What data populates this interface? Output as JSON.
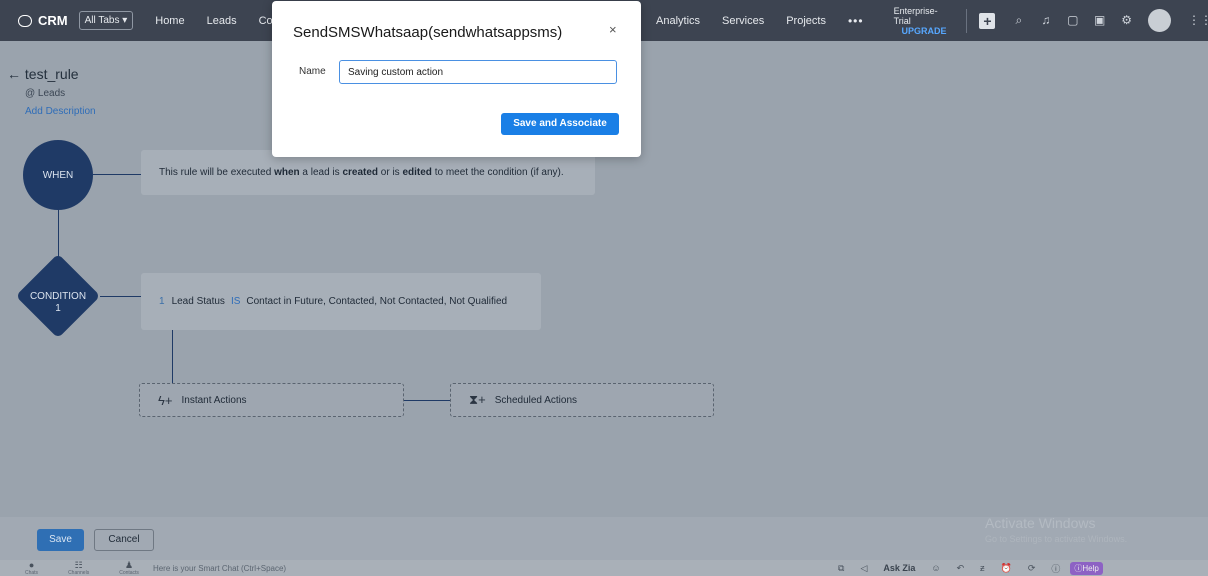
{
  "topbar": {
    "brand": "CRM",
    "all_tabs": "All Tabs ▾",
    "nav_left": [
      "Home",
      "Leads",
      "Co"
    ],
    "nav_right": [
      "Analytics",
      "Services",
      "Projects"
    ],
    "more": "•••",
    "trial_label": "Enterprise-Trial",
    "upgrade_label": "UPGRADE"
  },
  "rule": {
    "name": "test_rule",
    "module": "@ Leads",
    "add_description": "Add Description"
  },
  "flow": {
    "when_label": "WHEN",
    "when_text_parts": [
      "This rule will be executed ",
      "when",
      " a lead is ",
      "created",
      " or is ",
      "edited",
      " to meet the condition (if any)."
    ],
    "condition_label": "CONDITION",
    "condition_number": "1",
    "condition_row_num": "1",
    "condition_field": "Lead Status",
    "condition_operator": "IS",
    "condition_values": "Contact in Future, Contacted, Not Contacted, Not Qualified",
    "instant_actions": "Instant Actions",
    "scheduled_actions": "Scheduled Actions"
  },
  "footer": {
    "save": "Save",
    "cancel": "Cancel",
    "watermark_title": "Activate Windows",
    "watermark_sub": "Go to Settings to activate Windows."
  },
  "statusbar": {
    "items": [
      "Chats",
      "Channels",
      "Contacts"
    ],
    "smart_chat": "Here is your Smart Chat (Ctrl+Space)",
    "ask_zia": "Ask Zia",
    "help": "Help"
  },
  "modal": {
    "title": "SendSMSWhatsaap(sendwhatsappsms)",
    "close": "×",
    "name_label": "Name",
    "name_value": "Saving custom action",
    "associate_button": "Save and Associate"
  }
}
